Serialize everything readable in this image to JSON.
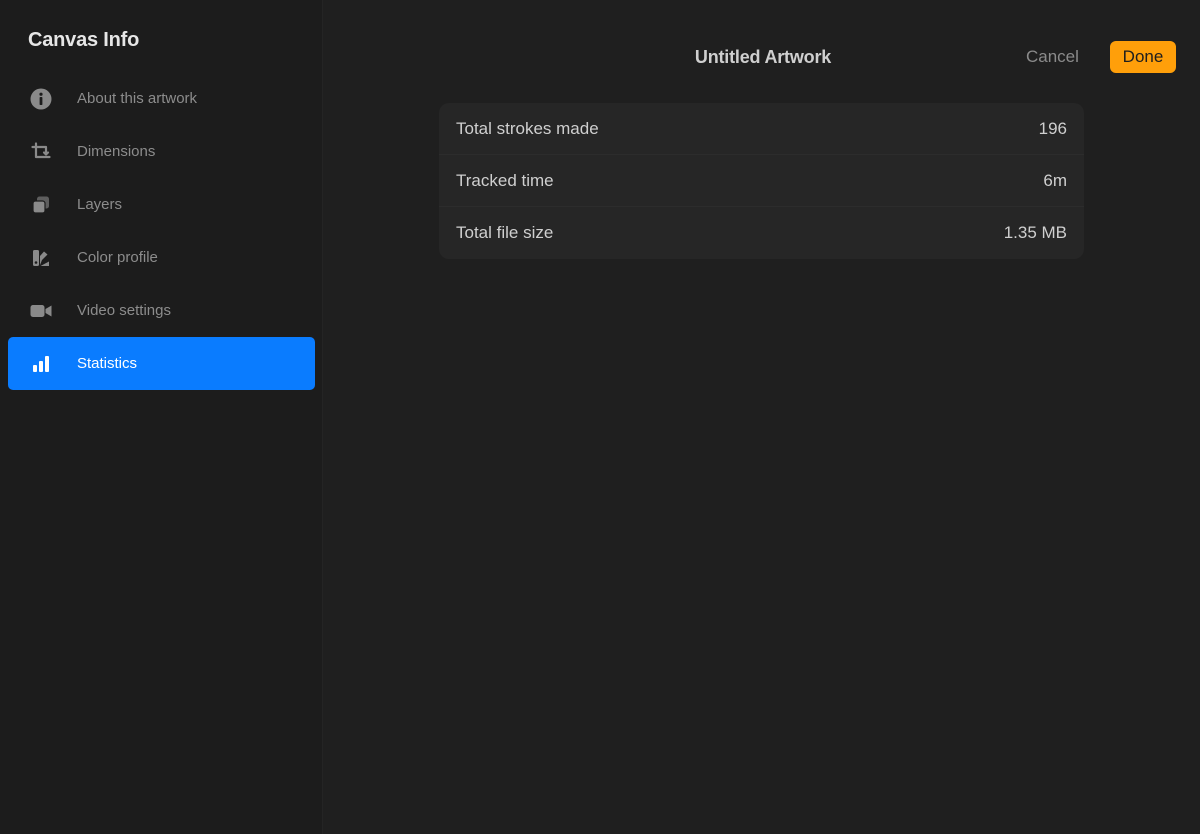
{
  "sidebar": {
    "title": "Canvas Info",
    "items": [
      {
        "label": "About this artwork",
        "icon": "info-icon",
        "active": false
      },
      {
        "label": "Dimensions",
        "icon": "crop-icon",
        "active": false
      },
      {
        "label": "Layers",
        "icon": "layers-icon",
        "active": false
      },
      {
        "label": "Color profile",
        "icon": "color-swatch-icon",
        "active": false
      },
      {
        "label": "Video settings",
        "icon": "video-camera-icon",
        "active": false
      },
      {
        "label": "Statistics",
        "icon": "bar-chart-icon",
        "active": true
      }
    ]
  },
  "header": {
    "title": "Untitled Artwork",
    "cancel_label": "Cancel",
    "done_label": "Done"
  },
  "statistics": {
    "rows": [
      {
        "label": "Total strokes made",
        "value": "196"
      },
      {
        "label": "Tracked time",
        "value": "6m"
      },
      {
        "label": "Total file size",
        "value": "1.35 MB"
      }
    ]
  },
  "colors": {
    "accent_blue": "#0a7cff",
    "done_orange": "#ff9f0a",
    "background": "#1f1f1f",
    "sidebar_background": "#1c1c1c",
    "card_background": "#262626"
  }
}
